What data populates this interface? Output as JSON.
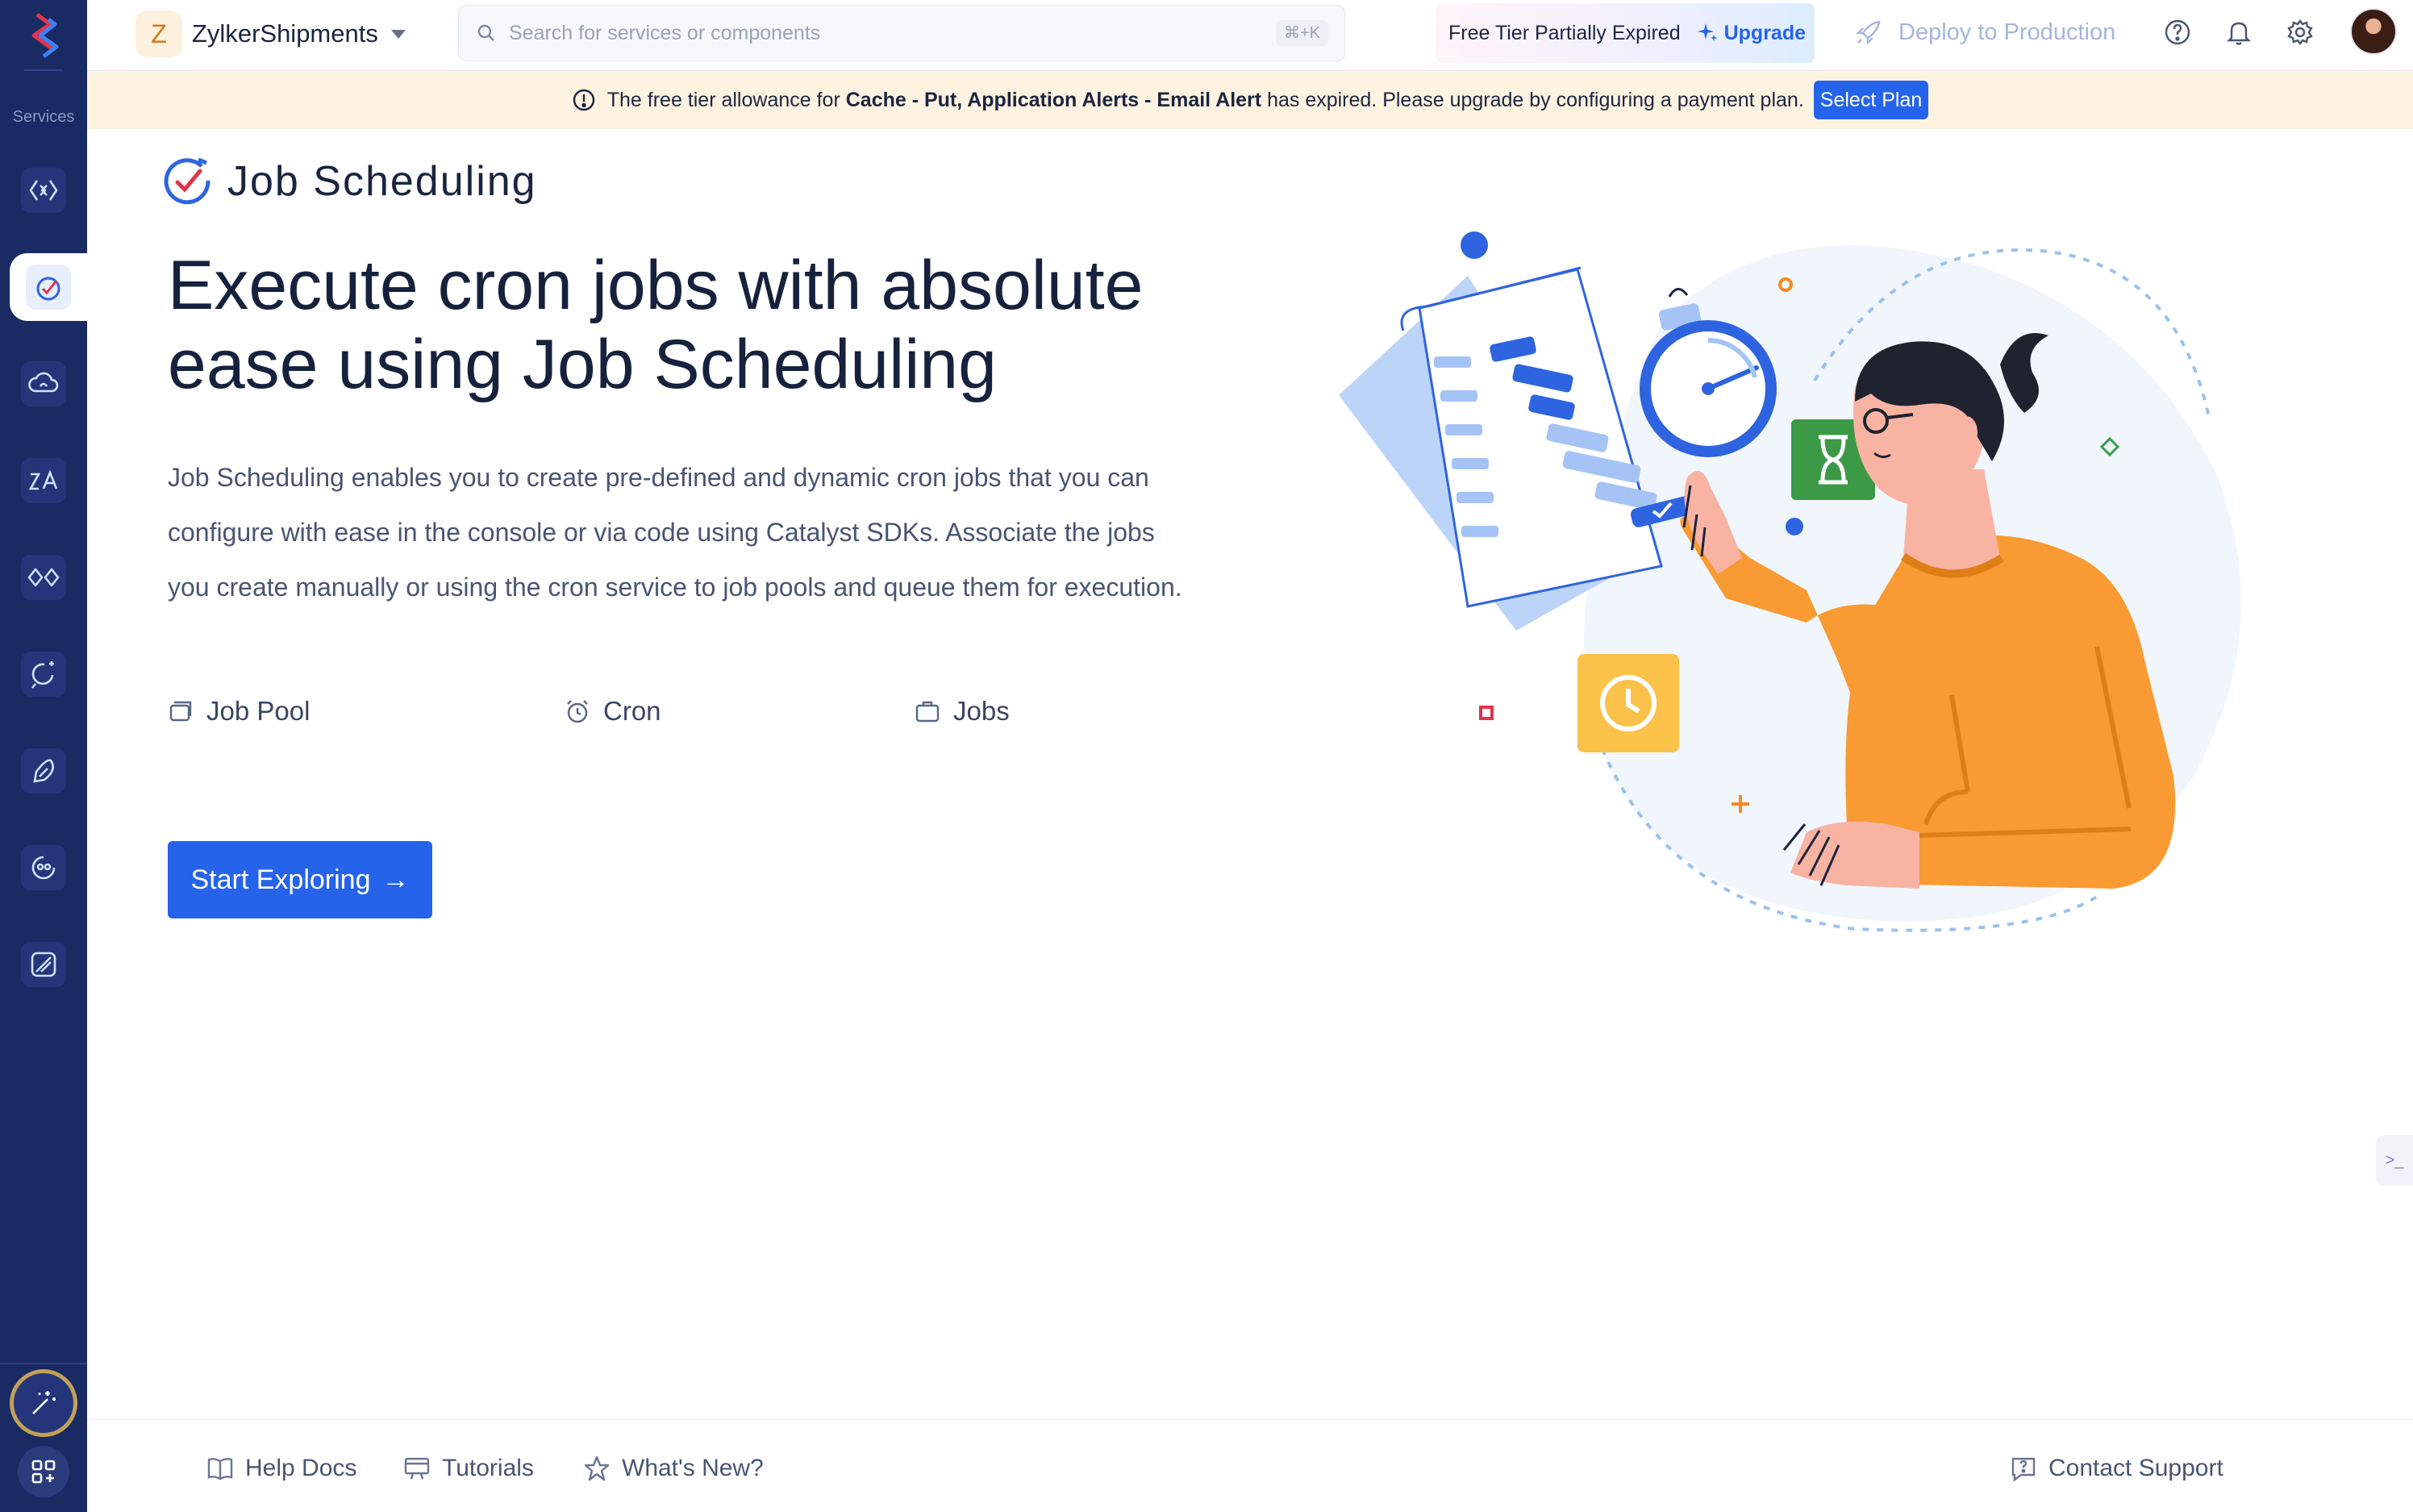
{
  "rail": {
    "label": "Services",
    "items": [
      "api-gateway-icon",
      "job-scheduling-icon",
      "cloud-functions-icon",
      "zia-icon",
      "connectors-icon",
      "quickml-icon",
      "pipelines-icon",
      "signals-icon",
      "data-icon"
    ],
    "active_index": 1
  },
  "topbar": {
    "project_initial": "Z",
    "project_name": "ZylkerShipments",
    "search_placeholder": "Search for services or components",
    "search_shortcut": "⌘+K",
    "tier_text": "Free Tier Partially Expired",
    "upgrade_label": "Upgrade",
    "deploy_label": "Deploy to Production"
  },
  "banner": {
    "prefix": "The free tier allowance for",
    "services": "Cache - Put, Application Alerts - Email Alert",
    "suffix": "has expired. Please upgrade by configuring a payment plan.",
    "button": "Select Plan"
  },
  "main": {
    "service_title": "Job Scheduling",
    "hero_line1": "Execute cron jobs with absolute",
    "hero_line2": "ease using Job Scheduling",
    "desc_line1": "Job Scheduling enables you to create pre-defined and dynamic cron jobs that you can",
    "desc_line2": "configure with ease in the console or via code using Catalyst SDKs. Associate the jobs",
    "desc_line3": "you create manually or using the cron service to job pools and queue them for execution.",
    "features": [
      {
        "label": "Job Pool",
        "icon": "job-pool-icon"
      },
      {
        "label": "Cron",
        "icon": "alarm-clock-icon"
      },
      {
        "label": "Jobs",
        "icon": "briefcase-icon"
      }
    ],
    "cta_label": "Start Exploring",
    "cta_arrow": "→"
  },
  "side_tab": ">_",
  "footer": {
    "help_docs": "Help Docs",
    "tutorials": "Tutorials",
    "whats_new": "What's New?",
    "contact_support": "Contact Support"
  },
  "colors": {
    "rail_bg": "#1a2a63",
    "accent": "#2563eb",
    "banner_bg": "#fdf3e0",
    "illustration_orange": "#f99a32"
  }
}
